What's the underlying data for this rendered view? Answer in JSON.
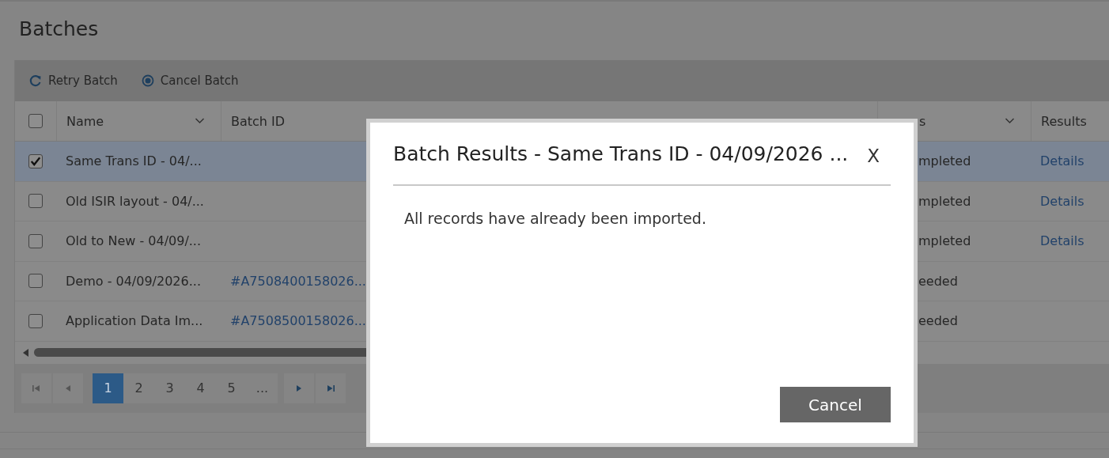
{
  "page_title": "Batches",
  "toolbar": [
    {
      "label": "Retry Batch",
      "kind": "retry"
    },
    {
      "label": "Cancel Batch",
      "kind": "cancel"
    }
  ],
  "table": {
    "select_all": {
      "checked": false
    },
    "columns": [
      {
        "label": "Name"
      },
      {
        "label": "Batch ID"
      },
      {
        "label": "s"
      },
      {
        "label": "Results"
      }
    ],
    "rows": [
      {
        "name": "Same Trans ID - 04/...",
        "batch_id": "",
        "status": "mpleted",
        "results": "Details",
        "checked": true,
        "selected": true
      },
      {
        "name": "Old ISIR layout - 04/...",
        "batch_id": "",
        "status": "mpleted",
        "results": "Details",
        "checked": false,
        "selected": false
      },
      {
        "name": "Old to New - 04/09/...",
        "batch_id": "",
        "status": "mpleted",
        "results": "Details",
        "checked": false,
        "selected": false
      },
      {
        "name": "Demo - 04/09/2026...",
        "batch_id": "#A7508400158026...",
        "status": "eeded",
        "results": "",
        "checked": false,
        "selected": false
      },
      {
        "name": "Application Data Im...",
        "batch_id": "#A7508500158026...",
        "status": "eeded",
        "results": "",
        "checked": false,
        "selected": false
      }
    ]
  },
  "pager": {
    "pages": [
      {
        "label": "1",
        "selected": true
      },
      {
        "label": "2",
        "selected": false
      },
      {
        "label": "3",
        "selected": false
      },
      {
        "label": "4",
        "selected": false
      },
      {
        "label": "5",
        "selected": false
      },
      {
        "label": "...",
        "selected": false
      }
    ]
  },
  "dialog": {
    "title": "Batch Results - Same Trans ID - 04/09/2026 ...",
    "close": "X",
    "message": "All records have already been imported.",
    "button": "Cancel"
  }
}
